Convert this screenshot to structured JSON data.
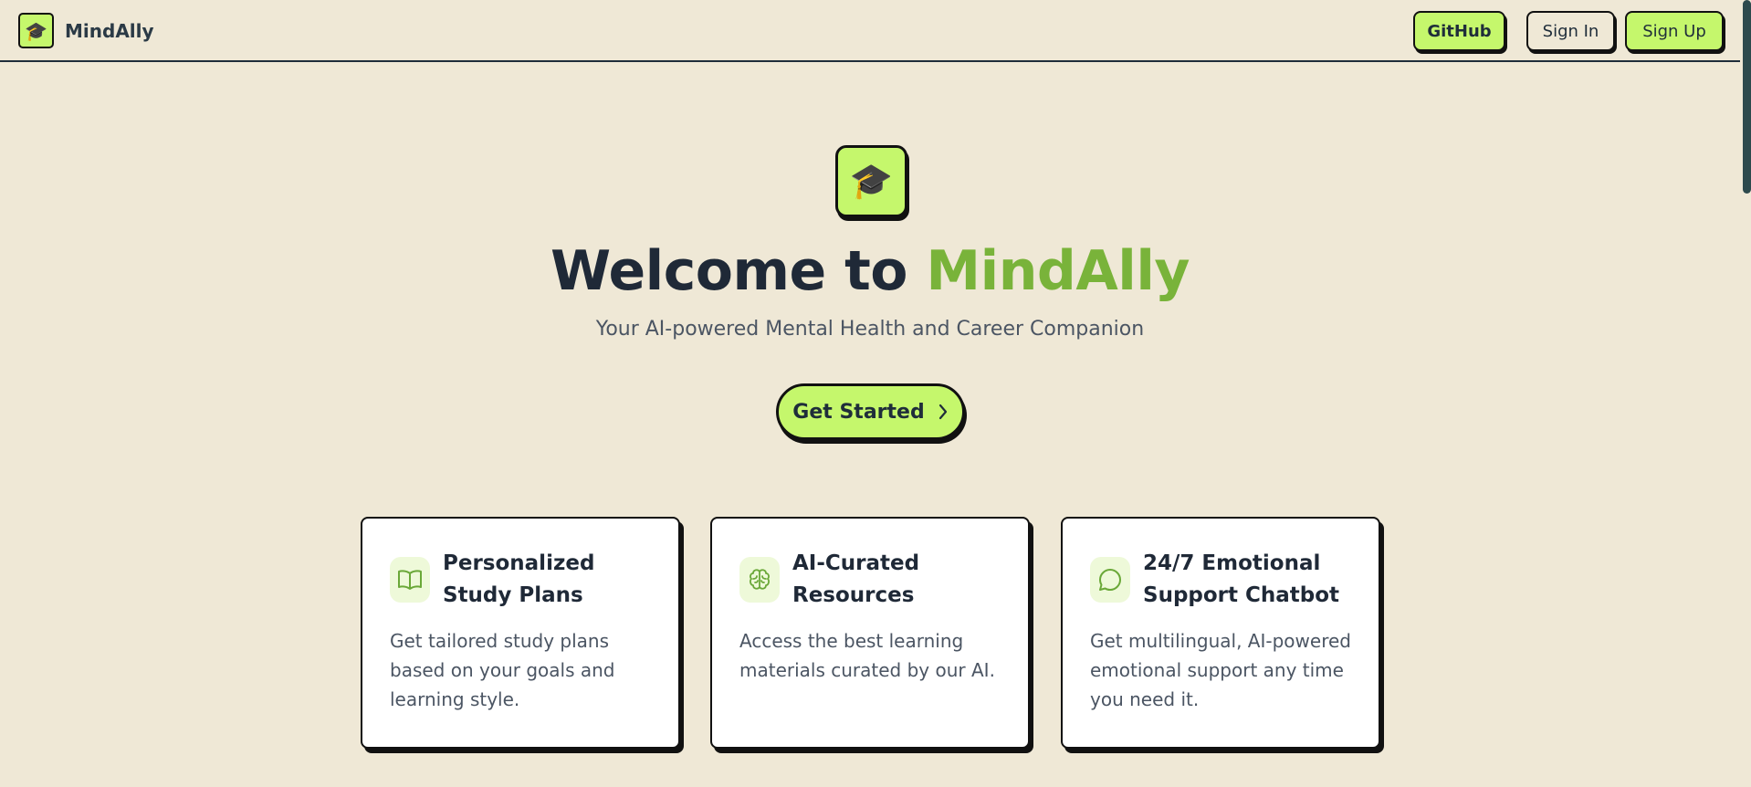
{
  "brand": {
    "name": "MindAlly",
    "logo_icon": "graduation-cap-icon"
  },
  "nav": {
    "github_label": "GitHub",
    "signin_label": "Sign In",
    "signup_label": "Sign Up"
  },
  "hero": {
    "icon": "graduation-cap-icon",
    "title_prefix": "Welcome to ",
    "title_accent": "MindAlly",
    "subtitle": "Your AI-powered Mental Health and Career Companion",
    "cta_label": "Get Started"
  },
  "features": [
    {
      "icon": "book-icon",
      "title": "Personalized Study Plans",
      "description": "Get tailored study plans based on your goals and learning style."
    },
    {
      "icon": "brain-icon",
      "title": "AI-Curated Resources",
      "description": "Access the best learning materials curated by our AI."
    },
    {
      "icon": "chat-bubble-icon",
      "title": "24/7 Emotional Support Chatbot",
      "description": "Get multilingual, AI-powered emotional support any time you need it."
    }
  ],
  "colors": {
    "background": "#efe8d6",
    "accent": "#c5f76c",
    "accent_text": "#79b33a",
    "ink": "#1f2937"
  }
}
